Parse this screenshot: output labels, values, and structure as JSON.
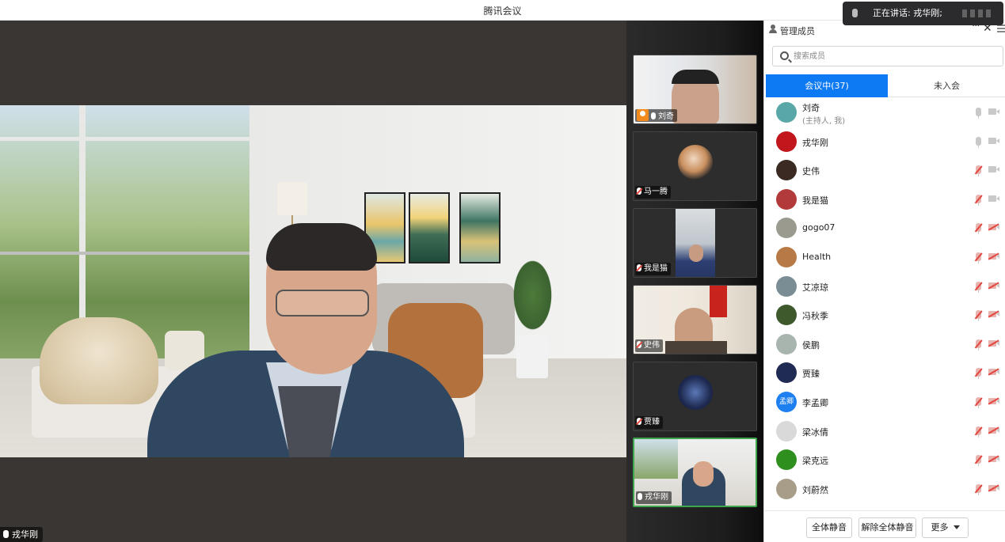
{
  "app": {
    "title": "腾讯会议"
  },
  "main_video": {
    "speaker_name": "戎华刚"
  },
  "thumbnails": [
    {
      "name": "刘奇",
      "mic": "on",
      "host": true
    },
    {
      "name": "马一腾",
      "mic": "off"
    },
    {
      "name": "我是猫",
      "mic": "off"
    },
    {
      "name": "史伟",
      "mic": "off"
    },
    {
      "name": "贾臻",
      "mic": "off"
    },
    {
      "name": "戎华刚",
      "mic": "on",
      "active": true
    }
  ],
  "toast": {
    "text": "正在讲话: 戎华刚;"
  },
  "panel": {
    "title": "管理成员",
    "more": "···",
    "close": "✕",
    "search_placeholder": "搜索成员",
    "tabs": [
      "会议中(37)",
      "未入会"
    ],
    "members": [
      {
        "name": "刘奇",
        "sub": "(主持人, 我)",
        "mic": "on",
        "cam": "on",
        "avatar_color": "#5aa7a8"
      },
      {
        "name": "戎华刚",
        "mic": "on",
        "cam": "on",
        "avatar_color": "#c0161c"
      },
      {
        "name": "史伟",
        "mic": "off",
        "cam": "on",
        "avatar_color": "#3a2a22"
      },
      {
        "name": "我是猫",
        "mic": "off",
        "cam": "on",
        "avatar_color": "#b23a3a"
      },
      {
        "name": "gogo07",
        "mic": "off",
        "cam": "off",
        "avatar_color": "#9a9a8e"
      },
      {
        "name": "Health",
        "mic": "off",
        "cam": "off",
        "avatar_color": "#b77a46"
      },
      {
        "name": "艾凉琼",
        "mic": "off",
        "cam": "off",
        "avatar_color": "#7a8c94"
      },
      {
        "name": "冯秋季",
        "mic": "off",
        "cam": "off",
        "avatar_color": "#3e5a2c"
      },
      {
        "name": "侯鹏",
        "mic": "off",
        "cam": "off",
        "avatar_color": "#a8b4ae"
      },
      {
        "name": "贾臻",
        "mic": "off",
        "cam": "off",
        "avatar_color": "#1f2b52"
      },
      {
        "name": "李孟卿",
        "avatar_text": "孟卿",
        "mic": "off",
        "cam": "off",
        "avatar_color": "#1e7ff0"
      },
      {
        "name": "梁冰倩",
        "mic": "off",
        "cam": "off",
        "avatar_color": "#d9d9d9"
      },
      {
        "name": "梁克远",
        "mic": "off",
        "cam": "off",
        "avatar_color": "#2f8f1e"
      },
      {
        "name": "刘蔚然",
        "mic": "off",
        "cam": "off",
        "avatar_color": "#a79d88"
      }
    ],
    "buttons": {
      "mute_all": "全体静音",
      "unmute_all": "解除全体静音",
      "more": "更多"
    }
  }
}
